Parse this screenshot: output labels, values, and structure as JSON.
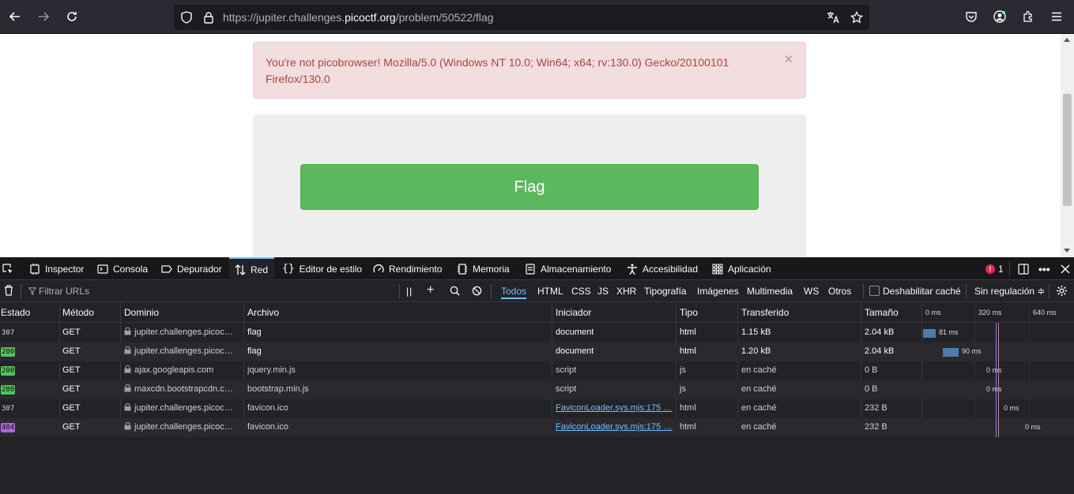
{
  "browser": {
    "url_prefix": "https://jupiter.challenges.",
    "url_host": "picoctf.org",
    "url_path": "/problem/50522/flag"
  },
  "page": {
    "alert_text": "You're not picobrowser! Mozilla/5.0 (Windows NT 10.0; Win64; x64; rv:130.0) Gecko/20100101 Firefox/130.0",
    "alert_close": "×",
    "flag_button": "Flag"
  },
  "devtools": {
    "tabs": [
      "Inspector",
      "Consola",
      "Depurador",
      "Red",
      "Editor de estilo",
      "Rendimiento",
      "Memoria",
      "Almacenamiento",
      "Accesibilidad",
      "Aplicación"
    ],
    "active_tab": "Red",
    "error_count": "1",
    "filter_placeholder": "Filtrar URLs",
    "type_filters": [
      "Todos",
      "HTML",
      "CSS",
      "JS",
      "XHR",
      "Tipografía",
      "Imágenes",
      "Multimedia",
      "WS",
      "Otros"
    ],
    "active_filter": "Todos",
    "disable_cache": "Deshabilitar caché",
    "throttling": "Sin regulación ≑",
    "columns": [
      "Estado",
      "Método",
      "Dominio",
      "Archivo",
      "Iniciador",
      "Tipo",
      "Transferido",
      "Tamaño"
    ],
    "timeline_ticks": [
      "0 ms",
      "320 ms",
      "640 ms"
    ],
    "requests": [
      {
        "status": "307",
        "method": "GET",
        "domain": "jupiter.challenges.picoc…",
        "file": "flag",
        "initiator": "document",
        "type": "html",
        "transferred": "1.15 kB",
        "size": "2.04 kB",
        "timing": "81 ms"
      },
      {
        "status": "200",
        "method": "GET",
        "domain": "jupiter.challenges.picoc…",
        "file": "flag",
        "initiator": "document",
        "type": "html",
        "transferred": "1.20 kB",
        "size": "2.04 kB",
        "timing": "90 ms"
      },
      {
        "status": "200",
        "method": "GET",
        "domain": "ajax.googleapis.com",
        "file": "jquery.min.js",
        "initiator": "script",
        "type": "js",
        "transferred": "en caché",
        "size": "0 B",
        "timing": "0 ms"
      },
      {
        "status": "200",
        "method": "GET",
        "domain": "maxcdn.bootstrapcdn.c…",
        "file": "bootstrap.min.js",
        "initiator": "script",
        "type": "js",
        "transferred": "en caché",
        "size": "0 B",
        "timing": "0 ms"
      },
      {
        "status": "307",
        "method": "GET",
        "domain": "jupiter.challenges.picoc…",
        "file": "favicon.ico",
        "initiator": "FaviconLoader.sys.mjs:175 …",
        "type": "html",
        "transferred": "en caché",
        "size": "232 B",
        "timing": "0 ms"
      },
      {
        "status": "404",
        "method": "GET",
        "domain": "jupiter.challenges.picoc…",
        "file": "favicon.ico",
        "initiator": "FaviconLoader.sys.mjs:175 …",
        "type": "html",
        "transferred": "en caché",
        "size": "232 B",
        "timing": "0 ms"
      }
    ]
  },
  "colors": {
    "alert_bg": "#f2dede",
    "alert_text": "#a94442",
    "flag_button": "#5cb85c",
    "status_200": "#51c45c",
    "status_404": "#b067d6",
    "devtools_accent": "#75bfff"
  },
  "icons": [
    "back-icon",
    "forward-icon",
    "reload-icon",
    "shield-icon",
    "lock-icon",
    "translate-icon",
    "star-icon",
    "pocket-icon",
    "account-icon",
    "extensions-icon",
    "menu-icon"
  ]
}
